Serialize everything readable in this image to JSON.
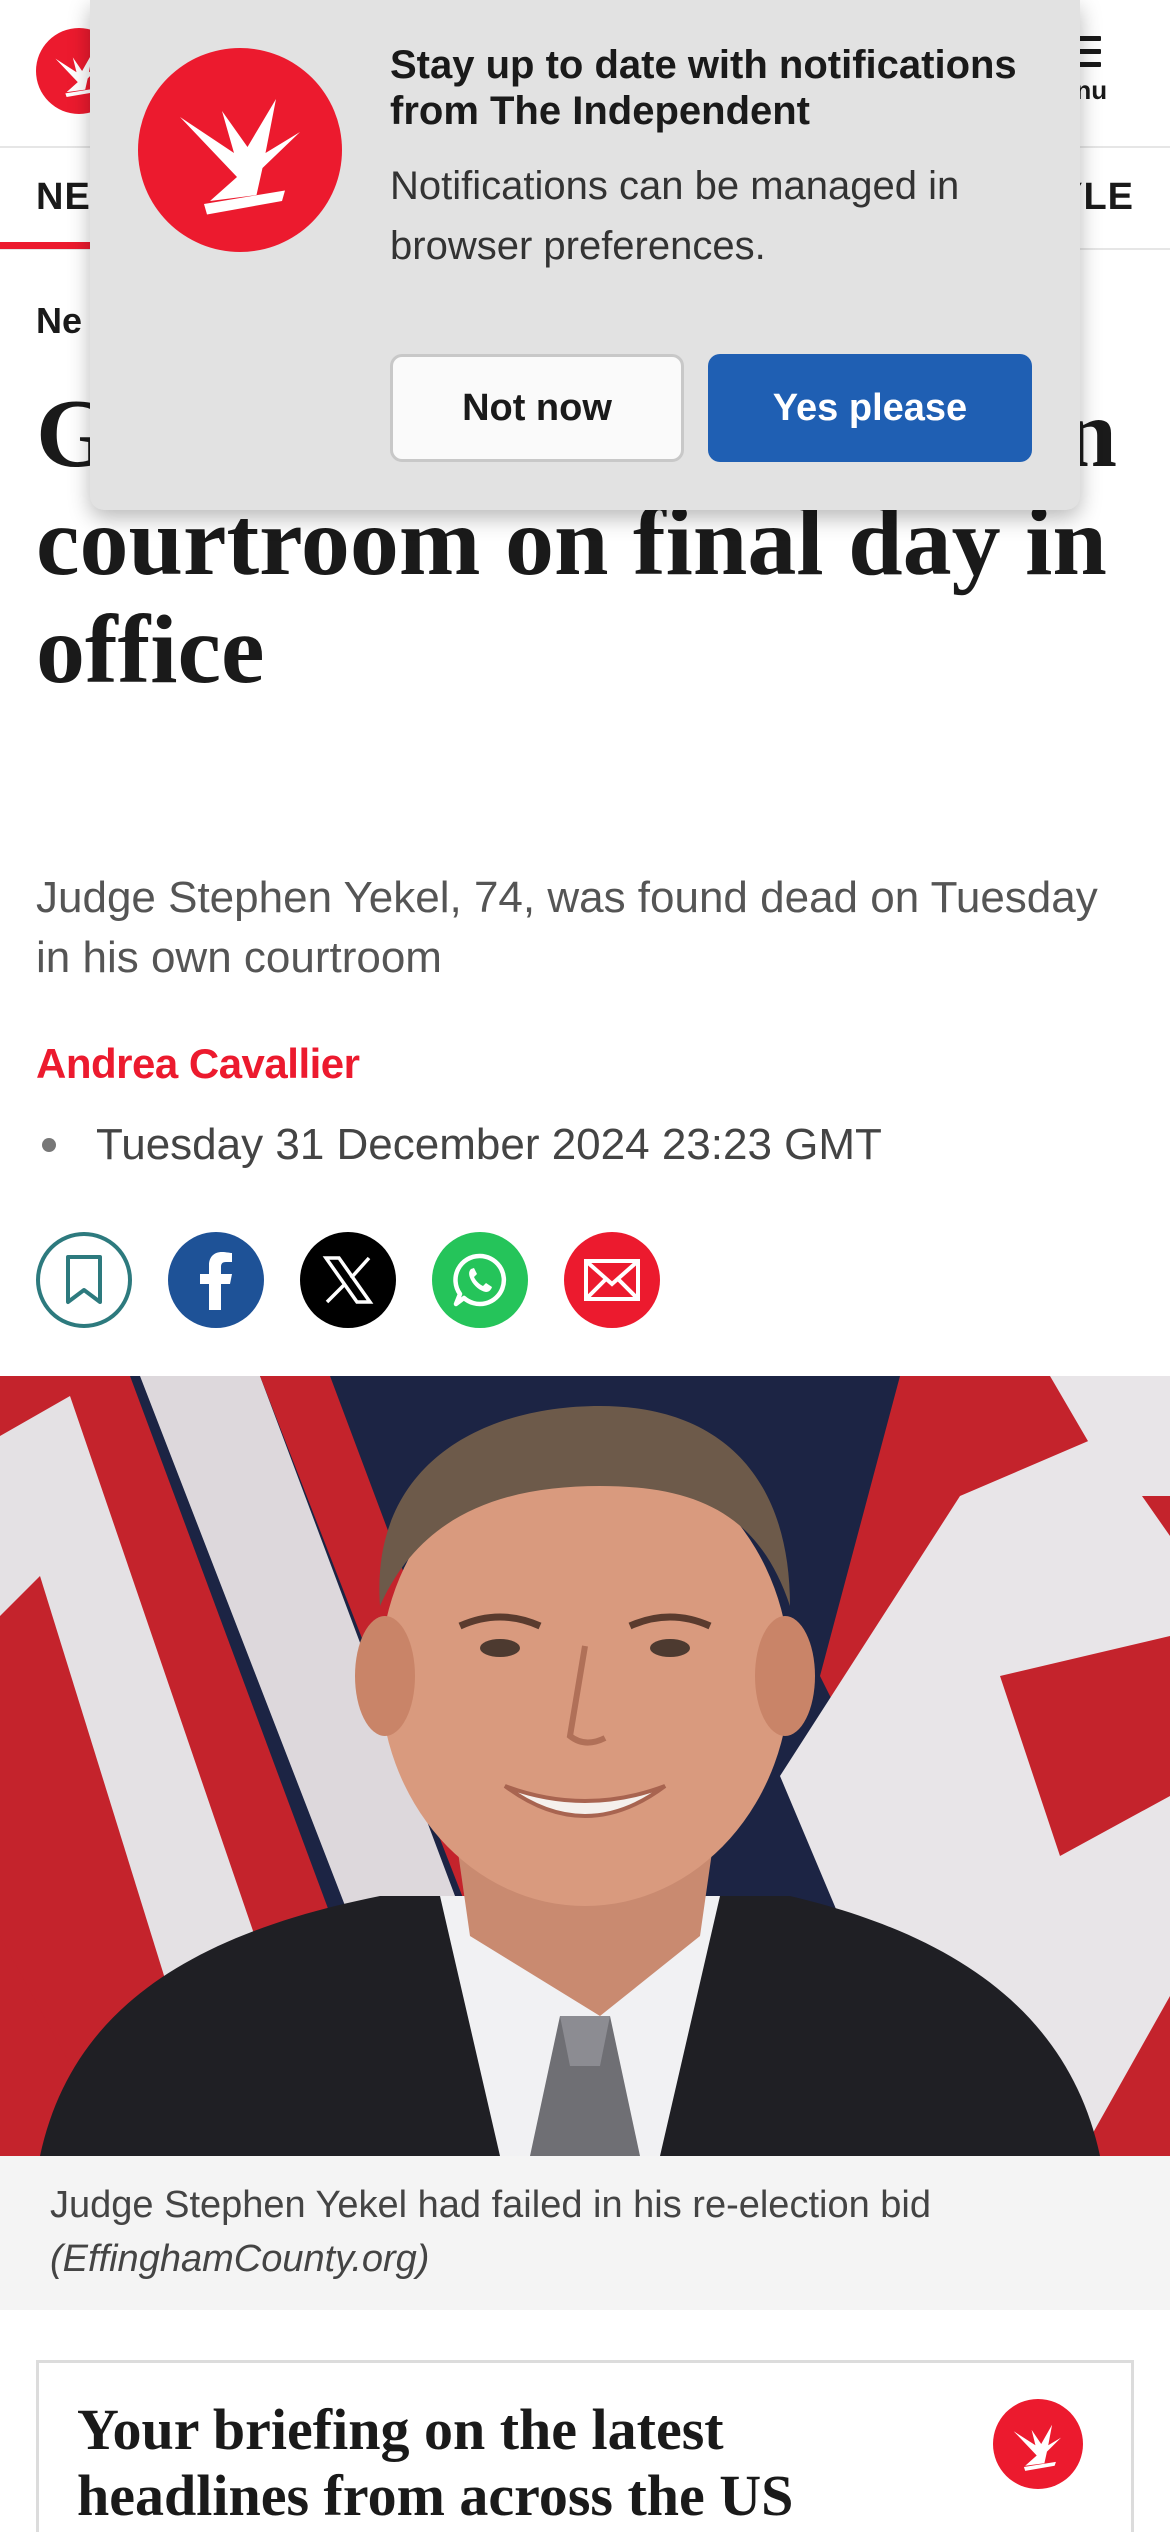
{
  "header": {
    "menu_label": "enu",
    "logo_icon": "eagle-logo-icon"
  },
  "nav": {
    "left_label": "NE",
    "right_label": "YLE"
  },
  "article": {
    "breadcrumb": "Ne",
    "headline": "G himself dead in his own courtroom on final day in office",
    "standfirst": "Judge Stephen Yekel, 74, was found dead on Tuesday in his own courtroom",
    "author": "Andrea Cavallier",
    "date": "Tuesday 31 December 2024 23:23 GMT",
    "share_icons": [
      "bookmark-icon",
      "facebook-icon",
      "x-icon",
      "whatsapp-icon",
      "email-icon"
    ],
    "image": {
      "caption": "Judge Stephen Yekel had failed in his re-election bid",
      "credit": "(EffinghamCounty.org)"
    }
  },
  "newsletter": {
    "title": "Your briefing on the latest headlines from across the US"
  },
  "notification_prompt": {
    "title": "Stay up to date with notifications from The Independent",
    "body": "Notifications can be managed in browser preferences.",
    "decline_label": "Not now",
    "accept_label": "Yes please"
  },
  "colors": {
    "brand_red": "#ec1a2e",
    "accept_blue": "#1f5fb3",
    "facebook_blue": "#1e5297",
    "whatsapp_green": "#25c45a",
    "bookmark_teal": "#2d7a7e"
  }
}
